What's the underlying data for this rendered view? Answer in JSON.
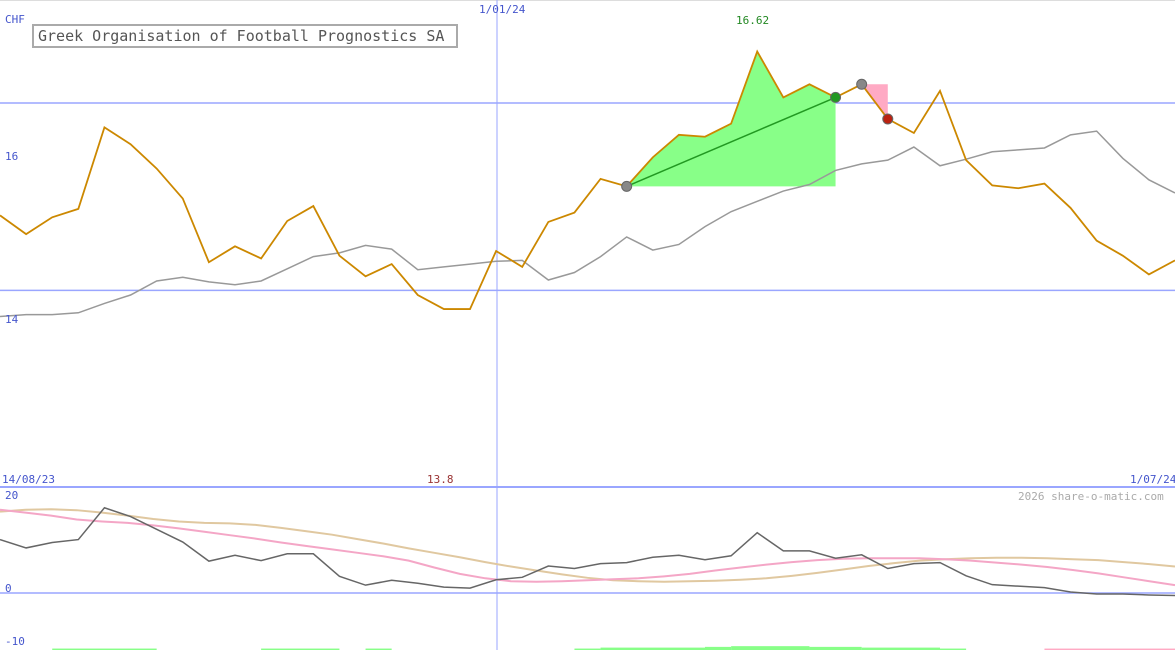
{
  "chart_data": {
    "type": "line",
    "title": "Greek Organisation of Football Prognostics SA",
    "currency": "CHF",
    "watermark": "2026 share-o-matic.com",
    "date_labels": {
      "start": "14/08/23",
      "mid": "1/01/24",
      "end": "1/07/24"
    },
    "ylim": [
      11.9,
      17.1
    ],
    "yticks": [
      {
        "value": 14,
        "label": "14"
      },
      {
        "value": 16,
        "label": "16"
      }
    ],
    "max_label": "16.62",
    "min_label": "13.8",
    "colors": {
      "price": "#cc8800",
      "average": "#999999",
      "hline": "#9aa6ff",
      "buy": "#88ff88",
      "sell": "#ffaac4",
      "trade_line": "#229922",
      "osc": "#666666",
      "osc_fast": "#f4a6c6",
      "osc_slow": "#e0c8a0",
      "max_label": "#228822",
      "min_label": "#993333",
      "axis_label": "#4455cc"
    },
    "series": [
      {
        "name": "price",
        "values": [
          14.8,
          14.6,
          14.78,
          14.87,
          15.74,
          15.56,
          15.3,
          14.98,
          14.3,
          14.47,
          14.34,
          14.74,
          14.9,
          14.37,
          14.15,
          14.28,
          13.95,
          13.8,
          13.8,
          14.42,
          14.25,
          14.73,
          14.83,
          15.19,
          15.11,
          15.42,
          15.66,
          15.64,
          15.78,
          16.55,
          16.06,
          16.2,
          16.06,
          16.2,
          15.83,
          15.68,
          16.13,
          15.39,
          15.12,
          15.09,
          15.14,
          14.88,
          14.53,
          14.37,
          14.17,
          14.32
        ]
      },
      {
        "name": "average",
        "values": [
          13.72,
          13.74,
          13.74,
          13.76,
          13.86,
          13.95,
          14.1,
          14.14,
          14.09,
          14.06,
          14.1,
          14.23,
          14.36,
          14.4,
          14.48,
          14.44,
          14.22,
          14.25,
          14.28,
          14.31,
          14.32,
          14.11,
          14.19,
          14.36,
          14.57,
          14.43,
          14.49,
          14.68,
          14.84,
          14.95,
          15.06,
          15.13,
          15.28,
          15.35,
          15.39,
          15.53,
          15.33,
          15.4,
          15.48,
          15.5,
          15.52,
          15.66,
          15.7,
          15.41,
          15.18,
          15.04
        ]
      }
    ],
    "trades": [
      {
        "type": "buy",
        "from_index": 24,
        "to_index": 32,
        "entry": 15.11,
        "exit": 16.06
      },
      {
        "type": "sell",
        "from_index": 33,
        "to_index": 34,
        "entry": 16.2,
        "exit": 15.83
      }
    ],
    "oscillator": {
      "ylim": [
        -10,
        20
      ],
      "yticks": [
        {
          "value": 20,
          "label": "20"
        },
        {
          "value": 0,
          "label": "0"
        },
        {
          "value": -10,
          "label": "-10"
        }
      ],
      "series": [
        {
          "name": "osc",
          "values": [
            10.9,
            9.2,
            10.3,
            10.9,
            17.4,
            15.6,
            13.0,
            10.4,
            6.5,
            7.7,
            6.6,
            8.0,
            8.0,
            3.4,
            1.6,
            2.6,
            2.0,
            1.2,
            1.0,
            2.7,
            3.2,
            5.5,
            5.0,
            6.0,
            6.2,
            7.3,
            7.7,
            6.8,
            7.6,
            12.3,
            8.6,
            8.6,
            7.1,
            7.8,
            5.0,
            6.0,
            6.2,
            3.5,
            1.7,
            1.4,
            1.1,
            0.2,
            -0.2,
            -0.2,
            -0.4,
            -0.5
          ]
        },
        {
          "name": "osc_fast",
          "values": [
            17.0,
            16.4,
            15.8,
            15.0,
            14.6,
            14.3,
            13.8,
            13.2,
            12.5,
            11.8,
            11.1,
            10.3,
            9.6,
            8.9,
            8.2,
            7.5,
            6.6,
            5.2,
            3.9,
            3.0,
            2.4,
            2.3,
            2.4,
            2.6,
            2.8,
            3.0,
            3.4,
            3.9,
            4.6,
            5.2,
            5.8,
            6.3,
            6.7,
            7.0,
            7.1,
            7.1,
            7.1,
            6.9,
            6.6,
            6.2,
            5.8,
            5.3,
            4.7,
            4.0,
            3.2,
            2.4,
            1.6
          ]
        },
        {
          "name": "osc_slow",
          "values": [
            16.6,
            17.0,
            17.1,
            16.9,
            16.4,
            15.8,
            15.1,
            14.6,
            14.3,
            14.2,
            13.9,
            13.3,
            12.6,
            11.9,
            11.0,
            10.1,
            9.1,
            8.2,
            7.3,
            6.3,
            5.4,
            4.6,
            3.8,
            3.1,
            2.6,
            2.4,
            2.3,
            2.4,
            2.5,
            2.7,
            3.0,
            3.5,
            4.1,
            4.8,
            5.5,
            6.1,
            6.6,
            6.9,
            7.1,
            7.2,
            7.2,
            7.1,
            6.9,
            6.7,
            6.3,
            5.9,
            5.4
          ]
        }
      ],
      "bars": [
        {
          "from_index": 2,
          "to_index": 6,
          "value": 1.2,
          "type": "buy"
        },
        {
          "from_index": 10,
          "to_index": 13,
          "value": 1.2,
          "type": "buy"
        },
        {
          "from_index": 14,
          "to_index": 15,
          "value": 1.2,
          "type": "buy"
        },
        {
          "from_index": 22,
          "to_index": 23,
          "value": 1.2,
          "type": "buy"
        },
        {
          "from_index": 23,
          "to_index": 27,
          "value": 2.0,
          "type": "buy"
        },
        {
          "from_index": 27,
          "to_index": 28,
          "value": 2.6,
          "type": "buy"
        },
        {
          "from_index": 28,
          "to_index": 31,
          "value": 3.2,
          "type": "buy"
        },
        {
          "from_index": 31,
          "to_index": 33,
          "value": 2.6,
          "type": "buy"
        },
        {
          "from_index": 33,
          "to_index": 36,
          "value": 2.0,
          "type": "buy"
        },
        {
          "from_index": 36,
          "to_index": 37,
          "value": 1.2,
          "type": "buy"
        },
        {
          "from_index": 40,
          "to_index": 45,
          "value": 1.2,
          "type": "sell"
        }
      ]
    }
  }
}
